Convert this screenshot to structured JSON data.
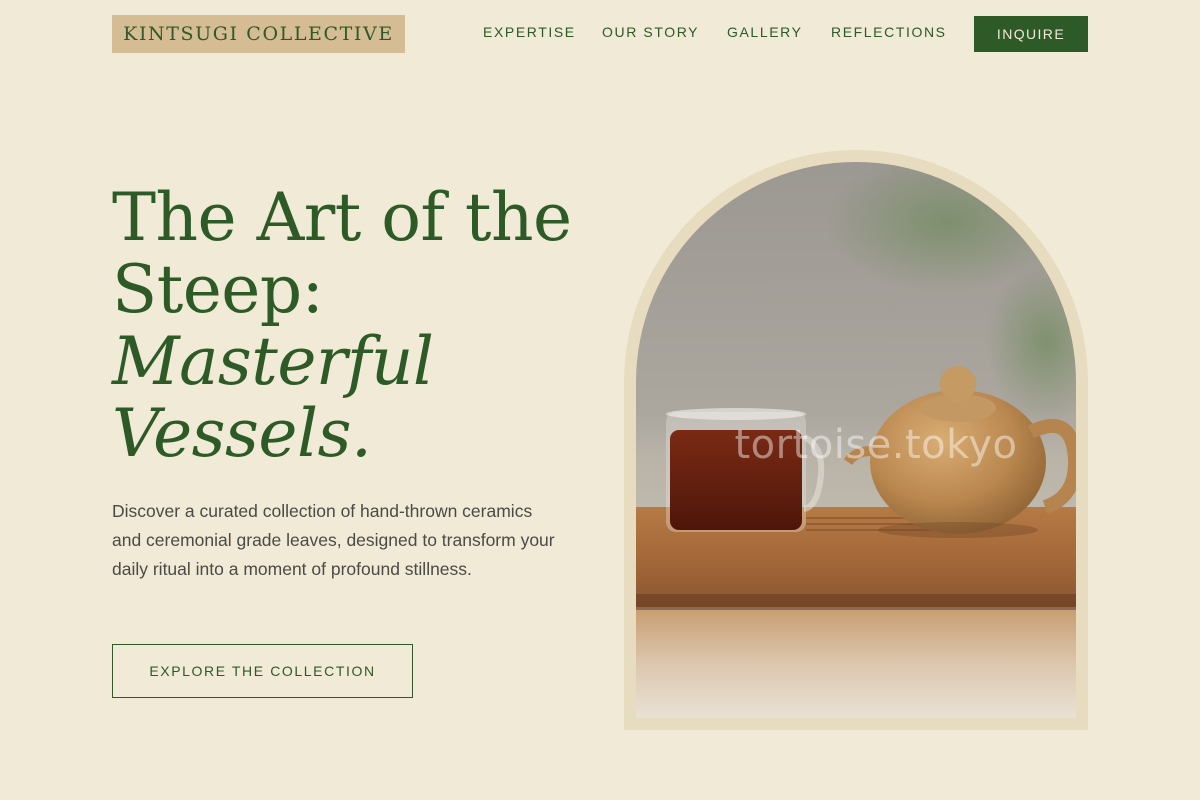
{
  "header": {
    "logo": "KINTSUGI COLLECTIVE",
    "nav": [
      "EXPERTISE",
      "OUR STORY",
      "GALLERY",
      "REFLECTIONS"
    ],
    "inquire_label": "INQUIRE"
  },
  "hero": {
    "title_line1": "The Art of the",
    "title_line2": "Steep:",
    "title_italic1": "Masterful",
    "title_italic2": "Vessels.",
    "description": "Discover a curated collection of hand-thrown ceramics and ceremonial grade leaves, designed to transform your daily ritual into a moment of profound stillness.",
    "cta_label": "EXPLORE THE COLLECTION"
  },
  "image": {
    "watermark": "tortoise.tokyo"
  },
  "colors": {
    "background": "#f0ead6",
    "accent": "#2d5a27",
    "logo_bg": "#d6bc94",
    "frame": "#e8dcc0"
  }
}
